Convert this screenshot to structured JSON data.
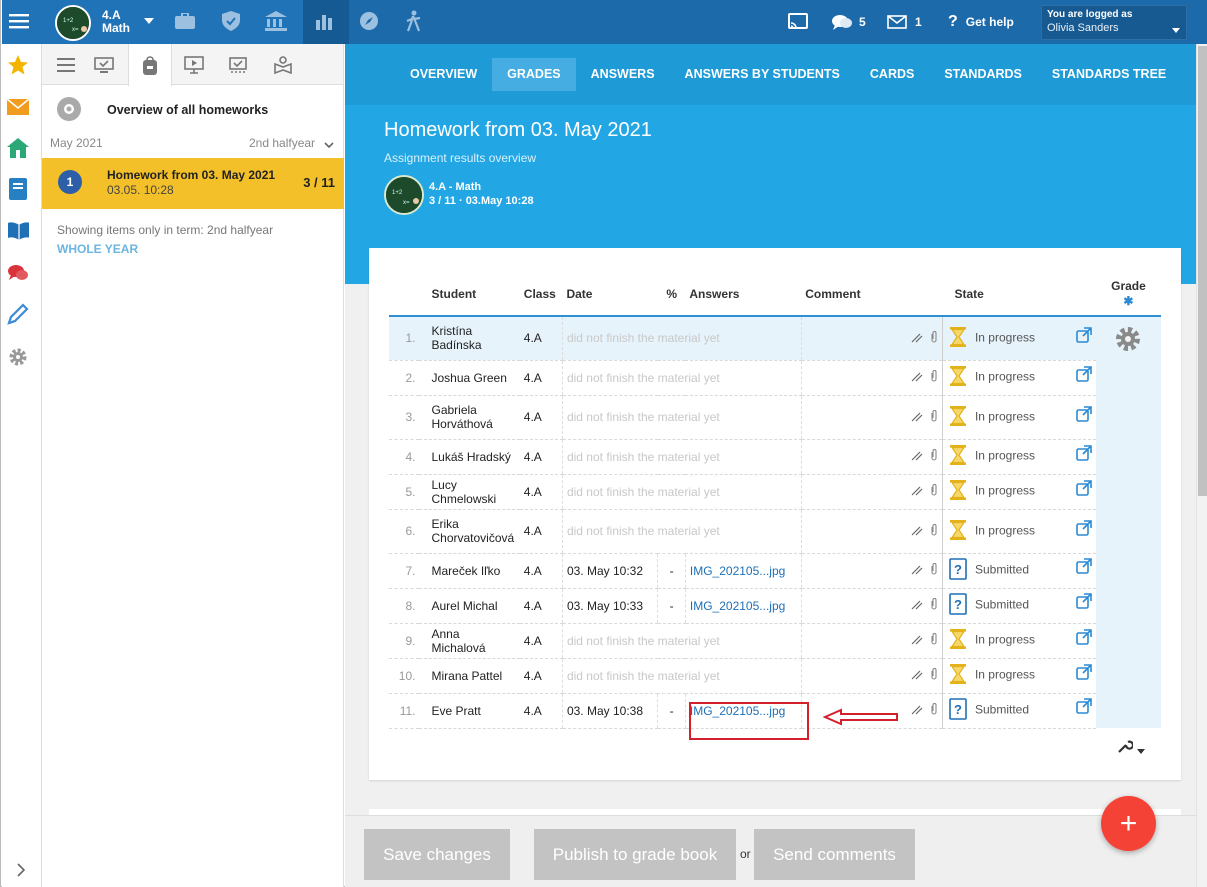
{
  "topbar": {
    "course_line1": "4.A",
    "course_line2": "Math",
    "messages_count": "5",
    "mail_count": "1",
    "help_label": "Get help",
    "login_label": "You are logged as",
    "login_user": "Olivia Sanders"
  },
  "sidebar": {
    "overview_label": "Overview of all homeworks",
    "term_month": "May 2021",
    "term_select": "2nd halfyear",
    "item": {
      "number": "1",
      "title": "Homework from 03. May 2021",
      "date": "03.05. 10:28",
      "count": "3 / 11"
    },
    "note": "Showing items only in term: 2nd halfyear",
    "whole_year": "WHOLE YEAR"
  },
  "nav_tabs": [
    "OVERVIEW",
    "GRADES",
    "ANSWERS",
    "ANSWERS BY STUDENTS",
    "CARDS",
    "STANDARDS",
    "STANDARDS TREE"
  ],
  "header": {
    "title": "Homework from 03. May 2021",
    "subtitle": "Assignment results overview",
    "course": "4.A - Math",
    "meta": "3 / 11 · 03.May 10:28"
  },
  "table": {
    "columns": {
      "student": "Student",
      "class": "Class",
      "date": "Date",
      "pct": "%",
      "answers": "Answers",
      "comment": "Comment",
      "state": "State",
      "grade": "Grade"
    },
    "rows": [
      {
        "num": "1.",
        "student": "Kristína Badínska",
        "class": "4.A",
        "date": "",
        "pct": "",
        "answer": "did not finish the material yet",
        "state": "In progress"
      },
      {
        "num": "2.",
        "student": "Joshua Green",
        "class": "4.A",
        "date": "",
        "pct": "",
        "answer": "did not finish the material yet",
        "state": "In progress"
      },
      {
        "num": "3.",
        "student": "Gabriela Horváthová",
        "class": "4.A",
        "date": "",
        "pct": "",
        "answer": "did not finish the material yet",
        "state": "In progress"
      },
      {
        "num": "4.",
        "student": "Lukáš Hradský",
        "class": "4.A",
        "date": "",
        "pct": "",
        "answer": "did not finish the material yet",
        "state": "In progress"
      },
      {
        "num": "5.",
        "student": "Lucy Chmelowski",
        "class": "4.A",
        "date": "",
        "pct": "",
        "answer": "did not finish the material yet",
        "state": "In progress"
      },
      {
        "num": "6.",
        "student": "Erika Chorvatovičová",
        "class": "4.A",
        "date": "",
        "pct": "",
        "answer": "did not finish the material yet",
        "state": "In progress"
      },
      {
        "num": "7.",
        "student": "Mareček Iľko",
        "class": "4.A",
        "date": "03. May 10:32",
        "pct": "-",
        "answer": "IMG_202105...jpg",
        "state": "Submitted"
      },
      {
        "num": "8.",
        "student": "Aurel Michal",
        "class": "4.A",
        "date": "03. May 10:33",
        "pct": "-",
        "answer": "IMG_202105...jpg",
        "state": "Submitted"
      },
      {
        "num": "9.",
        "student": "Anna Michalová",
        "class": "4.A",
        "date": "",
        "pct": "",
        "answer": "did not finish the material yet",
        "state": "In progress"
      },
      {
        "num": "10.",
        "student": "Mirana Pattel",
        "class": "4.A",
        "date": "",
        "pct": "",
        "answer": "did not finish the material yet",
        "state": "In progress"
      },
      {
        "num": "11.",
        "student": "Eve Pratt",
        "class": "4.A",
        "date": "03. May 10:38",
        "pct": "-",
        "answer": "IMG_202105...jpg",
        "state": "Submitted"
      }
    ]
  },
  "footer": {
    "save": "Save changes",
    "publish": "Publish to grade book",
    "or": "or",
    "send": "Send comments",
    "fab": "+"
  },
  "colors": {
    "primary": "#2173b7",
    "nav": "#1e9ad6",
    "selected_item": "#f4c029",
    "fab": "#f44236",
    "highlight": "#d4202a"
  }
}
